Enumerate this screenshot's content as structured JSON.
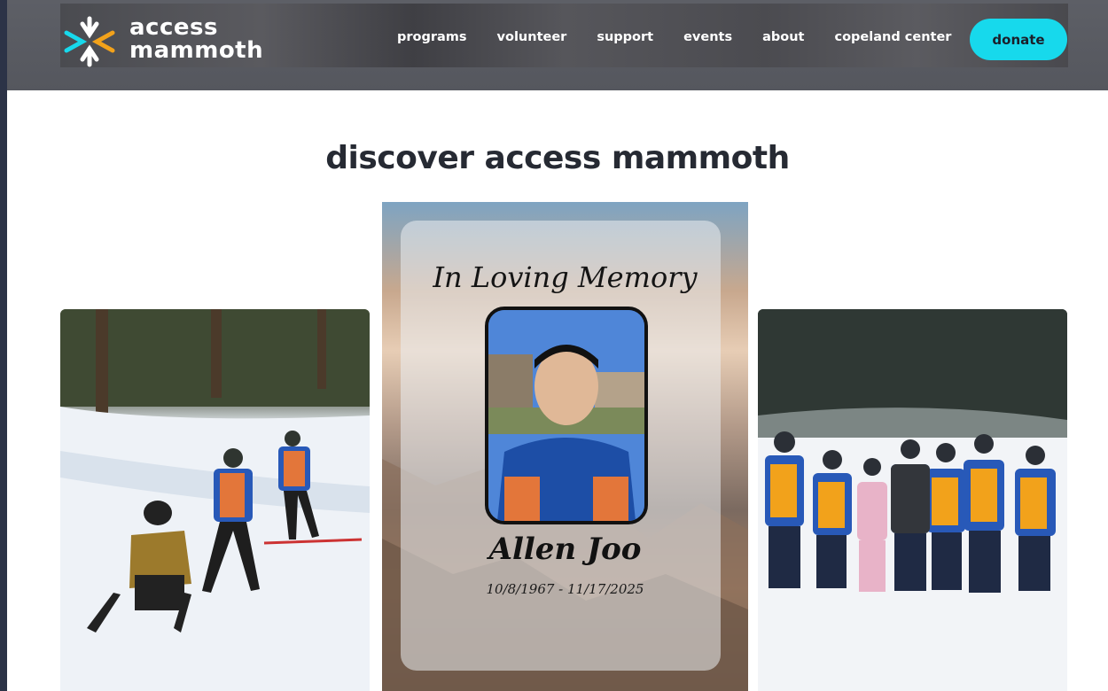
{
  "header": {
    "logo_line1": "access",
    "logo_line2": "mammoth",
    "nav": [
      "programs",
      "volunteer",
      "support",
      "events",
      "about",
      "copeland center"
    ],
    "donate_label": "donate",
    "accent_color": "#17d9ec"
  },
  "main": {
    "title": "discover access mammoth"
  },
  "memorial": {
    "heading": "In Loving Memory",
    "name": "Allen Joo",
    "dates": "10/8/1967 - 11/17/2025"
  },
  "photos": {
    "left": "adaptive-ski-lesson-photo",
    "right": "volunteer-group-photo"
  }
}
